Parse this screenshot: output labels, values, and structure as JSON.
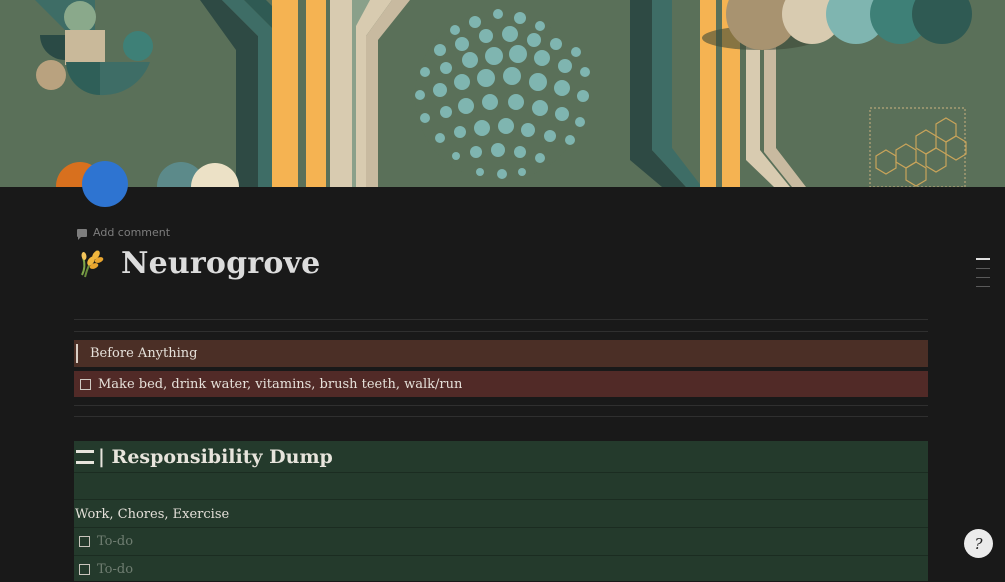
{
  "cover": {
    "colors": {
      "background": "#5a7059",
      "teal": "#3e6d66",
      "orange": "#f5b352",
      "cream": "#d8cbb0",
      "mint": "#7fb5b0",
      "brown": "#a89370",
      "blue": "#2e74d1"
    }
  },
  "avatar": {
    "color": "#2e74d1"
  },
  "page": {
    "add_comment": "Add comment",
    "title_icon": "🌾",
    "title": "Neurogrove"
  },
  "callouts": {
    "before_anything": "Before Anything",
    "morning_todo": "Make bed, drink water, vitamins, brush teeth, walk/run"
  },
  "responsibility": {
    "heading": "| Responsibility Dump",
    "subheading": "Work, Chores, Exercise",
    "todos": [
      "To-do",
      "To-do"
    ]
  },
  "help": {
    "label": "?"
  }
}
